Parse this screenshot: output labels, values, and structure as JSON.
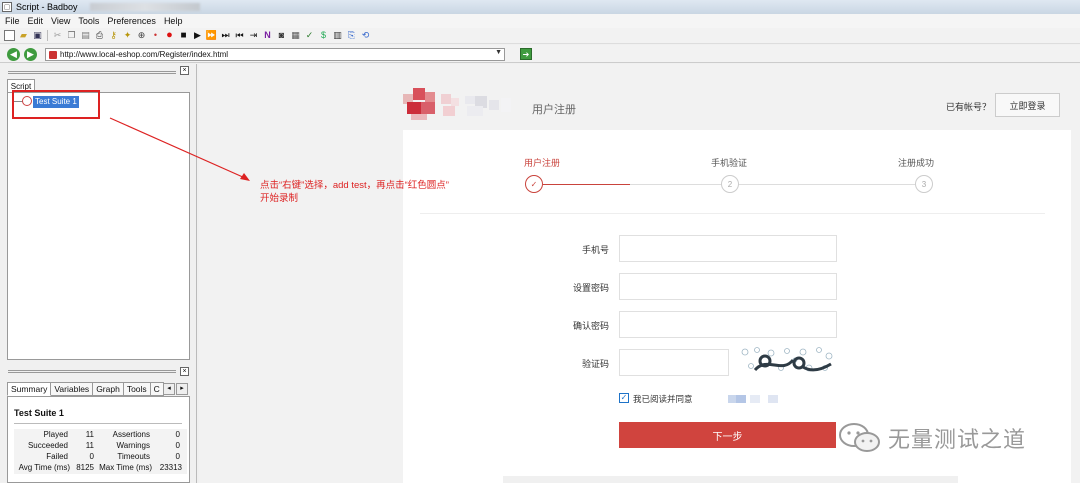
{
  "window": {
    "title": "Script - Badboy"
  },
  "menu": [
    "File",
    "Edit",
    "View",
    "Tools",
    "Preferences",
    "Help"
  ],
  "address": {
    "url": "http://www.local-eshop.com/Register/index.html"
  },
  "left_panel": {
    "tab": "Script",
    "tree_node": "Test Suite 1",
    "bottom_tabs": [
      "Summary",
      "Variables",
      "Graph",
      "Tools",
      "C"
    ],
    "summary": {
      "title": "Test Suite 1",
      "stats": [
        {
          "label": "Played",
          "value": "11",
          "label2": "Assertions",
          "value2": "0"
        },
        {
          "label": "Succeeded",
          "value": "11",
          "label2": "Warnings",
          "value2": "0"
        },
        {
          "label": "Failed",
          "value": "0",
          "label2": "Timeouts",
          "value2": "0"
        },
        {
          "label": "Avg Time (ms)",
          "value": "8125",
          "label2": "Max Time (ms)",
          "value2": "23313"
        }
      ]
    }
  },
  "annotation": {
    "line1": "点击“右键”选择，add test，再点击“红色圆点”",
    "line2": "开始录制"
  },
  "page": {
    "register_title": "用户注册",
    "have_account": "已有帐号？",
    "login_button": "立即登录",
    "steps": [
      {
        "label": "用户注册",
        "num": "✓",
        "active": true
      },
      {
        "label": "手机验证",
        "num": "2",
        "active": false
      },
      {
        "label": "注册成功",
        "num": "3",
        "active": false
      }
    ],
    "fields": [
      {
        "label": "手机号",
        "value": ""
      },
      {
        "label": "设置密码",
        "value": ""
      },
      {
        "label": "确认密码",
        "value": ""
      },
      {
        "label": "验证码",
        "value": ""
      }
    ],
    "agree_text": "我已阅读并同意",
    "next_button": "下一步"
  },
  "watermark": {
    "text": "无量测试之道"
  },
  "colors": {
    "accent": "#d0443e",
    "selection": "#3a7bd5",
    "annotation": "#dd2222"
  }
}
